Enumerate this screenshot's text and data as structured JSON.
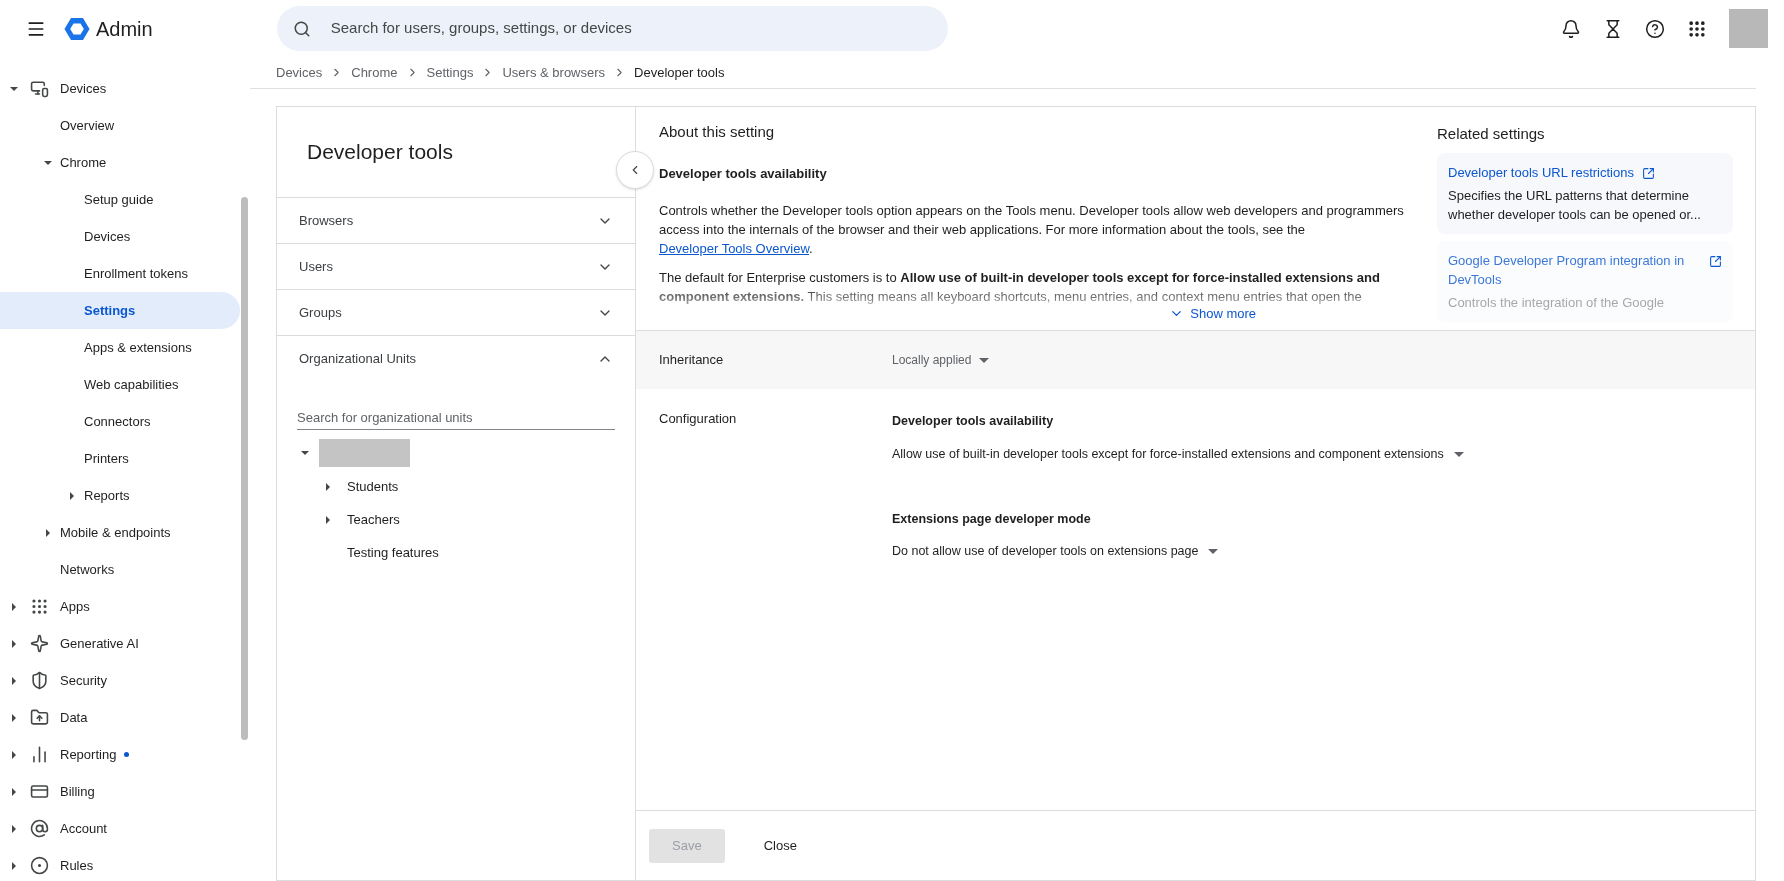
{
  "header": {
    "app_name": "Admin",
    "search": {
      "placeholder": "Search for users, groups, settings, or devices"
    }
  },
  "sidebar": {
    "items": [
      {
        "label": "Devices",
        "expanded": true,
        "children": [
          {
            "label": "Overview",
            "selected": false
          },
          {
            "label": "Chrome",
            "expanded": true,
            "children": [
              {
                "label": "Setup guide",
                "selected": false
              },
              {
                "label": "Devices",
                "selected": false
              },
              {
                "label": "Enrollment tokens",
                "selected": false
              },
              {
                "label": "Settings",
                "selected": true
              },
              {
                "label": "Apps & extensions",
                "selected": false
              },
              {
                "label": "Web capabilities",
                "selected": false
              },
              {
                "label": "Connectors",
                "selected": false
              },
              {
                "label": "Printers",
                "selected": false
              },
              {
                "label": "Reports",
                "expanded": false,
                "selected": false
              }
            ]
          },
          {
            "label": "Mobile & endpoints",
            "expanded": false,
            "selected": false
          },
          {
            "label": "Networks",
            "selected": false
          }
        ]
      },
      {
        "label": "Apps",
        "expanded": false,
        "selected": false
      },
      {
        "label": "Generative AI",
        "expanded": false,
        "selected": false
      },
      {
        "label": "Security",
        "expanded": false,
        "selected": false
      },
      {
        "label": "Data",
        "expanded": false,
        "selected": false
      },
      {
        "label": "Reporting",
        "expanded": false,
        "selected": false,
        "notification": true
      },
      {
        "label": "Billing",
        "expanded": false,
        "selected": false
      },
      {
        "label": "Account",
        "expanded": false,
        "selected": false
      },
      {
        "label": "Rules",
        "expanded": false,
        "selected": false
      }
    ]
  },
  "breadcrumbs": [
    "Devices",
    "Chrome",
    "Settings",
    "Users & browsers",
    "Developer tools"
  ],
  "left_panel": {
    "title": "Developer tools",
    "filters": [
      {
        "label": "Browsers",
        "expanded": false
      },
      {
        "label": "Users",
        "expanded": false
      },
      {
        "label": "Groups",
        "expanded": false
      },
      {
        "label": "Organizational Units",
        "expanded": true
      }
    ],
    "org_search": {
      "placeholder": "Search for organizational units"
    },
    "org_tree": {
      "expanded": true,
      "children": [
        {
          "label": "Students",
          "expanded": false
        },
        {
          "label": "Teachers",
          "expanded": false
        },
        {
          "label": "Testing features"
        }
      ]
    }
  },
  "about": {
    "heading": "About this setting",
    "subtitle": "Developer tools availability",
    "intro": {
      "text": "Controls whether the Developer tools option appears on the Tools menu. Developer tools allow web developers and programmers access into the internals of the browser and their web applications. For more information about the tools, see the ",
      "link": "Developer Tools Overview",
      "after": "."
    },
    "default_text": "The default for Enterprise customers is to **Allow use of built-in developer tools except for force-installed extensions and component extensions.** This setting means all keyboard shortcuts, menu entries, and context menu entries that open the",
    "show_more": "Show more"
  },
  "related": {
    "heading": "Related settings",
    "items": [
      {
        "title": "Developer tools URL restrictions",
        "description": "Specifies the URL patterns that determine whether developer tools can be opened or...",
        "faded": false
      },
      {
        "title": "Google Developer Program integration in DevTools",
        "description": "Controls the integration of the Google",
        "faded": true
      }
    ]
  },
  "policy": {
    "inheritance": {
      "label": "Inheritance",
      "value": "Locally applied"
    },
    "configuration": {
      "label": "Configuration",
      "settings": [
        {
          "title": "Developer tools availability",
          "value": "Allow use of built-in developer tools except for force-installed extensions and component extensions"
        },
        {
          "title": "Extensions page developer mode",
          "value": "Do not allow use of developer tools on extensions page"
        }
      ]
    }
  },
  "footer": {
    "buttons": [
      {
        "label": "Save",
        "kind": "primary",
        "disabled": true
      },
      {
        "label": "Close",
        "kind": "text",
        "disabled": false
      }
    ]
  }
}
